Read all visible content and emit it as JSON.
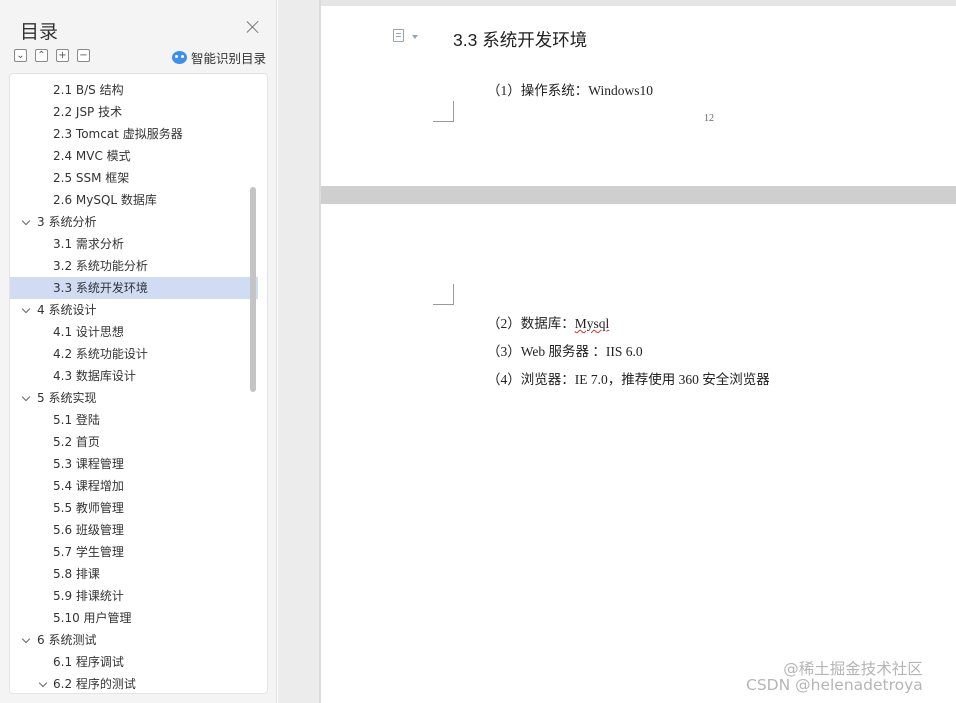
{
  "sidebar": {
    "title": "目录",
    "smart_toc_label": "智能识别目录",
    "tools": [
      {
        "name": "collapse-all-icon",
        "glyph": "⌄"
      },
      {
        "name": "expand-all-icon",
        "glyph": "⌃"
      },
      {
        "name": "add-entry-icon",
        "glyph": "+"
      },
      {
        "name": "remove-entry-icon",
        "glyph": "−"
      }
    ],
    "toc": [
      {
        "label": "2.1 B/S 结构",
        "level": 2
      },
      {
        "label": "2.2 JSP 技术",
        "level": 2
      },
      {
        "label": "2.3 Tomcat 虚拟服务器",
        "level": 2
      },
      {
        "label": "2.4 MVC 模式",
        "level": 2
      },
      {
        "label": "2.5 SSM 框架",
        "level": 2
      },
      {
        "label": "2.6 MySQL 数据库",
        "level": 2
      },
      {
        "label": "3 系统分析",
        "level": 1,
        "expanded": true
      },
      {
        "label": "3.1 需求分析",
        "level": 2
      },
      {
        "label": "3.2 系统功能分析",
        "level": 2
      },
      {
        "label": "3.3 系统开发环境",
        "level": 2,
        "active": true
      },
      {
        "label": "4 系统设计",
        "level": 1,
        "expanded": true
      },
      {
        "label": "4.1 设计思想",
        "level": 2
      },
      {
        "label": "4.2 系统功能设计",
        "level": 2
      },
      {
        "label": "4.3 数据库设计",
        "level": 2
      },
      {
        "label": "5 系统实现",
        "level": 1,
        "expanded": true
      },
      {
        "label": "5.1 登陆",
        "level": 2
      },
      {
        "label": "5.2 首页",
        "level": 2
      },
      {
        "label": "5.3 课程管理",
        "level": 2
      },
      {
        "label": "5.4 课程增加",
        "level": 2
      },
      {
        "label": "5.5 教师管理",
        "level": 2
      },
      {
        "label": "5.6 班级管理",
        "level": 2
      },
      {
        "label": "5.7 学生管理",
        "level": 2
      },
      {
        "label": "5.8 排课",
        "level": 2
      },
      {
        "label": "5.9 排课统计",
        "level": 2
      },
      {
        "label": "5.10 用户管理",
        "level": 2
      },
      {
        "label": "6 系统测试",
        "level": 1,
        "expanded": true
      },
      {
        "label": "6.1  程序调试",
        "level": 2
      },
      {
        "label": "6.2  程序的测试",
        "level": 2,
        "expanded": true
      }
    ]
  },
  "document": {
    "heading": "3.3 系统开发环境",
    "page1": {
      "para_os": "（1）操作系统：Windows10",
      "page_number": "12"
    },
    "page2": {
      "para_db_prefix": "（2）数据库：",
      "para_db_value": "Mysql",
      "para_web": "（3）Web 服务器 ：IIS 6.0",
      "para_browser": "（4）浏览器：IE 7.0，推荐使用 360 安全浏览器"
    }
  },
  "watermark": {
    "line1": "@稀土掘金技术社区",
    "line2": "CSDN @helenadetroya"
  }
}
